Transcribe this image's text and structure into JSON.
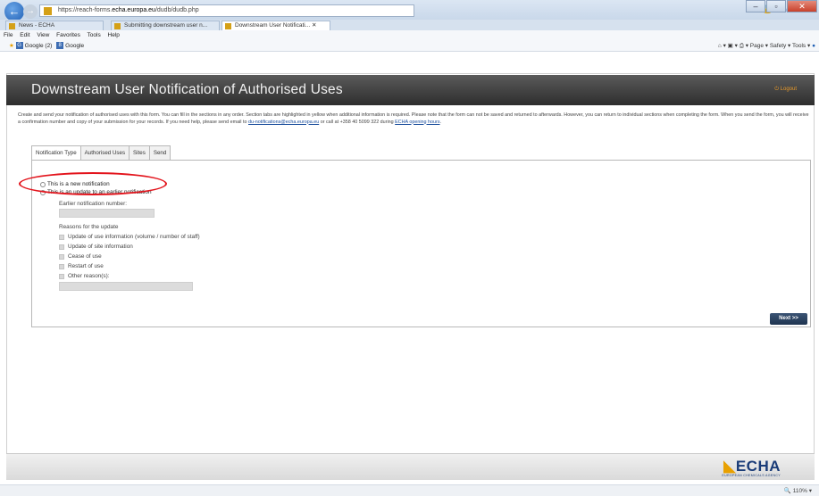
{
  "browser": {
    "url_prefix": "https://reach-forms.",
    "url_host": "echa.europa.eu",
    "url_path": "/dudb/dudb.php",
    "tabs": [
      {
        "label": "News - ECHA"
      },
      {
        "label": "Submitting downstream user n..."
      },
      {
        "label": "Downstream User Notificati... ✕"
      }
    ],
    "menu": [
      "File",
      "Edit",
      "View",
      "Favorites",
      "Tools",
      "Help"
    ],
    "favorites": [
      "Google (2)",
      "Google"
    ],
    "command_bar": "Page ▾   Safety ▾   Tools ▾",
    "zoom": "110%"
  },
  "page": {
    "title": "Downstream User Notification of Authorised Uses",
    "logout": "Logout",
    "intro_1": "Create and send your notification of authorised uses with this form. You can fill in the sections in any order. Section tabs are highlighted in yellow when additional information is required. Please note that the form can not be saved and returned to afterwards. However, you can return to individual sections when completing the form. When you send the form, you will receive a confirmation number and copy of your submission for your records. If you need help, please send email to ",
    "intro_email": "du-notifications@echa.europa.eu",
    "intro_2": " or call at +358 40 5099 322 during ",
    "intro_hours": "ECHA opening hours",
    "intro_3": "."
  },
  "form": {
    "tabs": [
      "Notification Type",
      "Authorised Uses",
      "Sites",
      "Send"
    ],
    "option_new": "This is a new notification",
    "option_update": "This is an update to an earlier notification",
    "earlier_label": "Earlier notification number:",
    "reasons_label": "Reasons for the update",
    "reasons": [
      "Update of use information (volume / number of staff)",
      "Update of site information",
      "Cease of use",
      "Restart of use",
      "Other reason(s):"
    ],
    "next_label": "Next >>"
  },
  "footer": {
    "logo": "ECHA",
    "logo_sub": "EUROPEAN CHEMICALS AGENCY"
  },
  "colors": {
    "header_bg": "#3a3a3a",
    "highlight_oval": "#e3141c",
    "next_button": "#2b4262",
    "logout": "#e89a2a"
  }
}
